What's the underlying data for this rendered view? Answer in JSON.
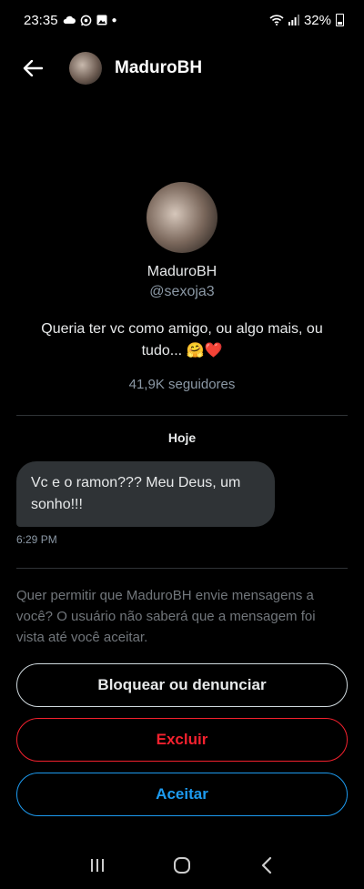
{
  "status_bar": {
    "time": "23:35",
    "battery": "32%",
    "left_icons": [
      "cloud-icon",
      "whatsapp-icon",
      "gallery-icon",
      "dot-icon"
    ],
    "right_icons": [
      "wifi-icon",
      "signal-icon",
      "battery-icon"
    ]
  },
  "header": {
    "name": "MaduroBH"
  },
  "profile": {
    "name": "MaduroBH",
    "handle": "@sexoja3",
    "bio": "Queria ter vc como amigo, ou algo mais, ou tudo... 🤗❤️",
    "followers": "41,9K seguidores"
  },
  "conversation": {
    "date_label": "Hoje",
    "messages": [
      {
        "text": "Vc e o ramon??? Meu Deus, um sonho!!!",
        "time": "6:29 PM"
      }
    ]
  },
  "request": {
    "prompt": "Quer permitir que MaduroBH envie mensagens a você? O usuário não saberá que a mensagem foi vista até você aceitar.",
    "block_label": "Bloquear ou denunciar",
    "delete_label": "Excluir",
    "accept_label": "Aceitar"
  },
  "colors": {
    "background": "#000000",
    "delete": "#f4212e",
    "accept": "#1d9bf0",
    "bubble": "#2f3336"
  },
  "nav": [
    "recents-icon",
    "home-icon",
    "back-nav-icon"
  ]
}
